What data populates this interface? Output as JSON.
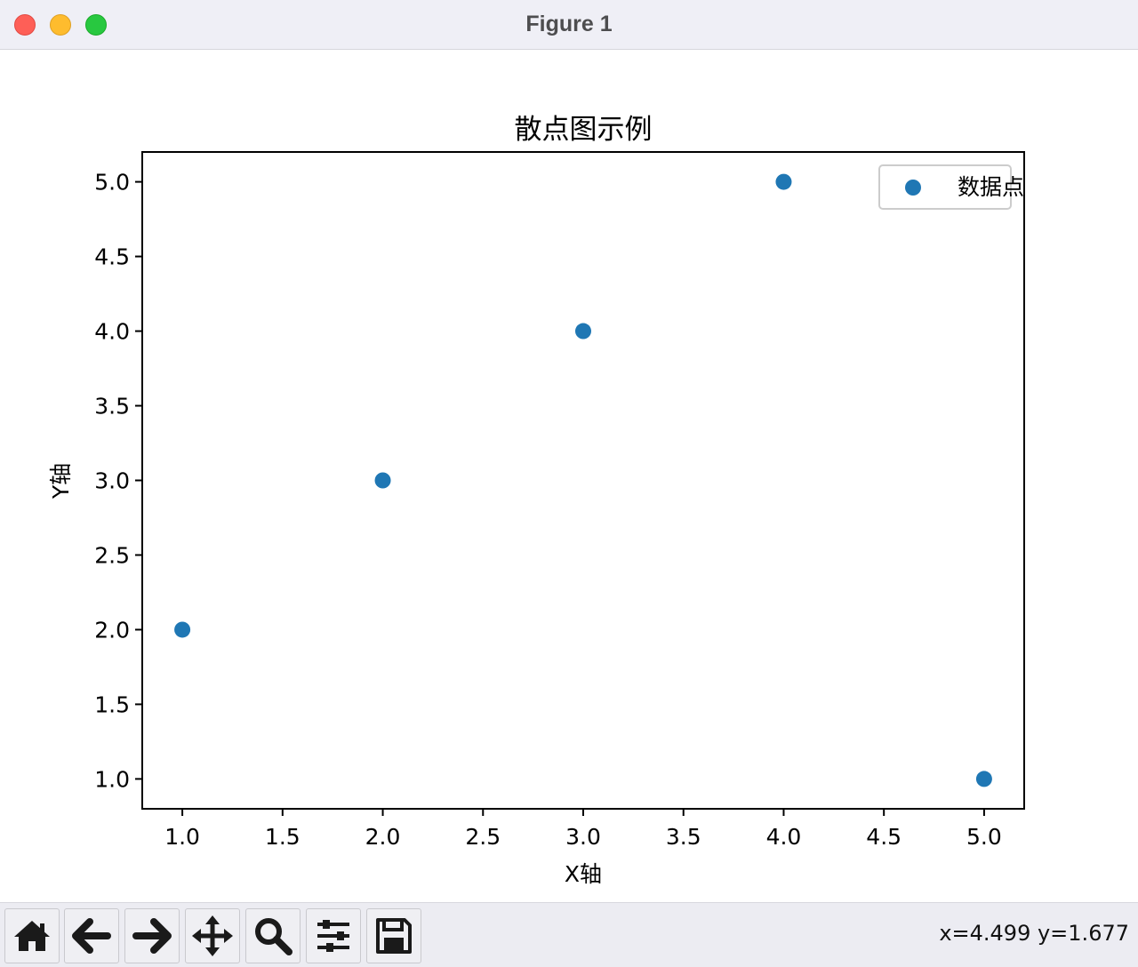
{
  "window": {
    "title": "Figure 1"
  },
  "chart_data": {
    "type": "scatter",
    "title": "散点图示例",
    "xlabel": "X轴",
    "ylabel": "Y轴",
    "x": [
      1,
      2,
      3,
      4,
      5
    ],
    "y": [
      2,
      3,
      4,
      5,
      1
    ],
    "series": [
      {
        "name": "数据点",
        "x": [
          1,
          2,
          3,
          4,
          5
        ],
        "y": [
          2,
          3,
          4,
          5,
          1
        ],
        "color": "#1f77b4"
      }
    ],
    "xlim": [
      0.8,
      5.2
    ],
    "ylim": [
      0.8,
      5.2
    ],
    "xticks": [
      "1.0",
      "1.5",
      "2.0",
      "2.5",
      "3.0",
      "3.5",
      "4.0",
      "4.5",
      "5.0"
    ],
    "yticks": [
      "1.0",
      "1.5",
      "2.0",
      "2.5",
      "3.0",
      "3.5",
      "4.0",
      "4.5",
      "5.0"
    ],
    "grid": false,
    "legend_position": "top-right"
  },
  "toolbar": {
    "buttons": [
      {
        "icon": "home-icon"
      },
      {
        "icon": "arrow-left-icon"
      },
      {
        "icon": "arrow-right-icon"
      },
      {
        "icon": "move-icon"
      },
      {
        "icon": "zoom-icon"
      },
      {
        "icon": "sliders-icon"
      },
      {
        "icon": "save-icon"
      }
    ],
    "coords": "x=4.499 y=1.677"
  },
  "colors": {
    "marker": "#1f77b4",
    "titlebar": "#efeff6",
    "toolbar": "#ececf2"
  }
}
